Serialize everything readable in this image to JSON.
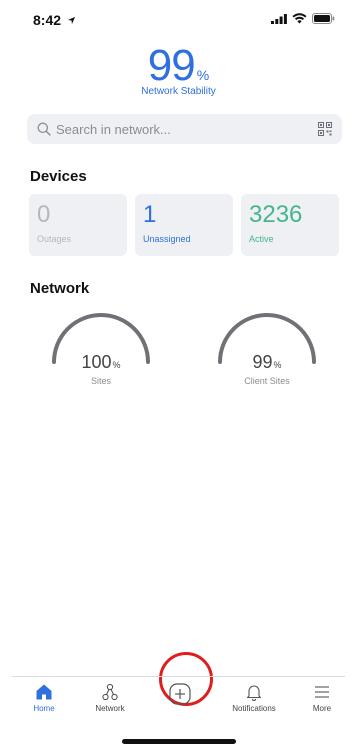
{
  "status": {
    "time": "8:42"
  },
  "hero": {
    "value": "99",
    "unit": "%",
    "label": "Network Stability",
    "accent": "#2f6fe0"
  },
  "search": {
    "placeholder": "Search in network..."
  },
  "devices": {
    "title": "Devices",
    "cards": [
      {
        "value": "0",
        "label": "Outages",
        "color": "#b4b7bc"
      },
      {
        "value": "1",
        "label": "Unassigned",
        "color": "#2f6fe0"
      },
      {
        "value": "3236",
        "label": "Active",
        "color": "#45b58a"
      }
    ]
  },
  "network": {
    "title": "Network",
    "gauges": [
      {
        "value": "100",
        "unit": "%",
        "label": "Sites",
        "percent": 100
      },
      {
        "value": "99",
        "unit": "%",
        "label": "Client Sites",
        "percent": 99
      }
    ]
  },
  "tabs": [
    {
      "label": "Home",
      "icon": "home-icon",
      "active": true
    },
    {
      "label": "Network",
      "icon": "network-icon",
      "active": false
    },
    {
      "label": "",
      "icon": "add-icon",
      "active": false
    },
    {
      "label": "Notifications",
      "icon": "bell-icon",
      "active": false
    },
    {
      "label": "More",
      "icon": "menu-icon",
      "active": false
    }
  ],
  "highlight_color": "#e01d1d"
}
